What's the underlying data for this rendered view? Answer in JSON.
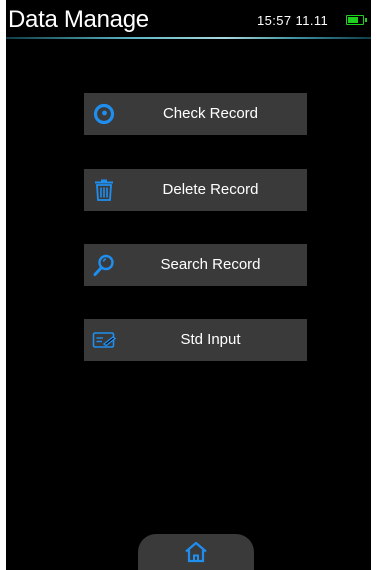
{
  "header": {
    "title": "Data Manage",
    "time": "15:57  11.11",
    "battery_level": 0.8
  },
  "menu": {
    "items": [
      {
        "label": "Check Record",
        "icon": "record-circle-icon"
      },
      {
        "label": "Delete Record",
        "icon": "trash-icon"
      },
      {
        "label": "Search Record",
        "icon": "search-icon"
      },
      {
        "label": "Std Input",
        "icon": "input-card-icon"
      }
    ]
  },
  "footer": {
    "icon": "home-icon"
  },
  "colors": {
    "accent": "#1e8ff0",
    "button_bg": "#3a3a3a",
    "background": "#000000",
    "battery": "#1fd11f"
  }
}
